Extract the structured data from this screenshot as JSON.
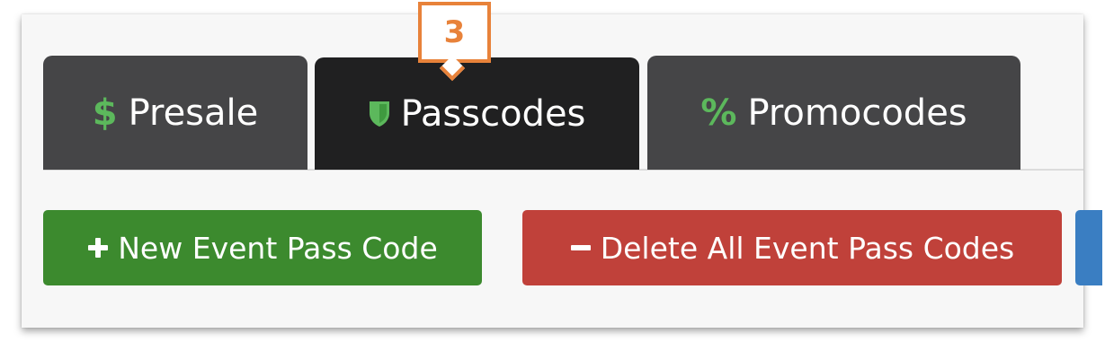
{
  "tabs": [
    {
      "label": "Presale",
      "glyph": "$",
      "icon": "dollar-icon",
      "active": false
    },
    {
      "label": "Passcodes",
      "glyph": "",
      "icon": "shield-icon",
      "active": true
    },
    {
      "label": "Promocodes",
      "glyph": "%",
      "icon": "percent-icon",
      "active": false
    }
  ],
  "actions": {
    "new_label": "New Event Pass Code",
    "delete_label": "Delete All Event Pass Codes"
  },
  "callout": {
    "number": "3"
  },
  "colors": {
    "tab_inactive": "#454547",
    "tab_active": "#202021",
    "icon_green": "#5cb85c",
    "new_button": "#3c8a2e",
    "delete_button": "#c0413a",
    "partial_button": "#3a7ec2",
    "callout_orange": "#e8823a"
  }
}
